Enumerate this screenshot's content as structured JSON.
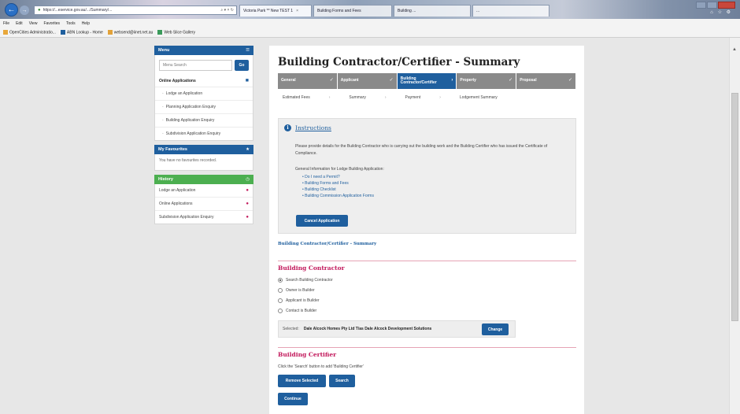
{
  "browser": {
    "address": "https://...eservice.gov.au/.../Summary/...",
    "address_controls": "⌕ ▾ × ↻",
    "tabs": [
      {
        "label": "Victoria Park ** New TEST 1",
        "active": true
      },
      {
        "label": "Building Forms and Fees",
        "active": false
      },
      {
        "label": "Building ...",
        "active": false
      },
      {
        "label": "...",
        "active": false
      }
    ],
    "menu": [
      "File",
      "Edit",
      "View",
      "Favorites",
      "Tools",
      "Help"
    ],
    "favorites": [
      "OpenCities Administratio...",
      "ABN Lookup - Home",
      "websend@iinet.net.au",
      "Web Slice Gallery"
    ],
    "sys_icons": "⌂ ☆ ⚙"
  },
  "sidebar": {
    "menu_title": "Menu",
    "search_placeholder": "Menu Search",
    "go_label": "Go",
    "online_apps_label": "Online Applications",
    "online_items": [
      "Lodge an Application",
      "Planning Application Enquiry",
      "Building Application Enquiry",
      "Subdivision Application Enquiry"
    ],
    "favourites_title": "My Favourites",
    "favourites_empty": "You have no favourites recorded.",
    "history_title": "History",
    "history_items": [
      "Lodge an Application",
      "Online Applications",
      "Subdivision Application Enquiry"
    ]
  },
  "main": {
    "title": "Building Contractor/Certifier - Summary",
    "steps": [
      {
        "label": "General",
        "done": true,
        "active": false
      },
      {
        "label": "Applicant",
        "done": true,
        "active": false
      },
      {
        "label": "Building Contractor/Certifier",
        "done": false,
        "active": true
      },
      {
        "label": "Property",
        "done": true,
        "active": false
      },
      {
        "label": "Proposal",
        "done": true,
        "active": false
      }
    ],
    "substeps": [
      "Estimated Fees",
      "Summary",
      "Payment",
      "Lodgement Summary"
    ],
    "instructions": {
      "title": "Instructions",
      "text": "Please provide details for the Building Contractor who is carrying out the building work and the Building Certifier who has issued the Certificate of Compliance.",
      "general": "General Information for Lodge Building Application:",
      "links": [
        "Do I need a Permit?",
        "Building Forms and Fees",
        "Building Checklist",
        "Building Commission Application Forms"
      ],
      "cancel_label": "Cancel Application"
    },
    "summary_link": "Building Contractor/Certifier - Summary",
    "contractor": {
      "heading": "Building Contractor",
      "options": [
        {
          "label": "Search Building Contractor",
          "checked": true
        },
        {
          "label": "Owner is Builder",
          "checked": false
        },
        {
          "label": "Applicant is Builder",
          "checked": false
        },
        {
          "label": "Contact is Builder",
          "checked": false
        }
      ],
      "selected_label": "Selected:",
      "selected_value": "Dale Alcock Homes Pty Ltd T/as Dale Alcock Development Solutions",
      "change_label": "Change"
    },
    "certifier": {
      "heading": "Building Certifier",
      "note": "Click the 'Search' button to add 'Building Certifier'",
      "remove_label": "Remove Selected",
      "search_label": "Search"
    },
    "continue_label": "Continue"
  },
  "colors": {
    "primary": "#1f5f9e",
    "accent": "#c2185b",
    "history_green": "#4caf50",
    "step_grey": "#8a8a8a"
  },
  "icons": [
    "back-arrow-icon",
    "lock-icon",
    "menu-hamburger-icon",
    "folder-icon",
    "star-icon",
    "clock-icon",
    "info-icon",
    "checkmark-icon",
    "chevron-right-icon",
    "dot-icon"
  ]
}
